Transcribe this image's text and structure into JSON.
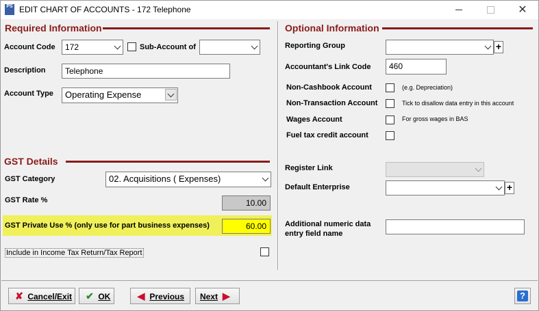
{
  "window": {
    "app_icon_text": "PS",
    "title": "EDIT CHART OF ACCOUNTS - 172 Telephone"
  },
  "required": {
    "section_title": "Required Information",
    "account_code_label": "Account Code",
    "account_code_value": "172",
    "sub_account_label": "Sub-Account of",
    "sub_account_value": "",
    "description_label": "Description",
    "description_value": "Telephone",
    "account_type_label": "Account Type",
    "account_type_value": "Operating Expense"
  },
  "gst": {
    "section_title": "GST Details",
    "category_label": "GST Category",
    "category_value": "02. Acquisitions ( Expenses)",
    "rate_label": "GST Rate %",
    "rate_value": "10.00",
    "private_use_label": "GST Private Use % (only use for part business expenses)",
    "private_use_value": "60.00",
    "include_label": "Include in Income Tax Return/Tax Report"
  },
  "optional": {
    "section_title": "Optional Information",
    "reporting_group_label": "Reporting Group",
    "reporting_group_value": "",
    "accountant_link_label": "Accountant's Link Code",
    "accountant_link_value": "460",
    "non_cashbook_label": "Non-Cashbook Account",
    "non_cashbook_hint": "(e.g. Depreciation)",
    "non_transaction_label": "Non-Transaction Account",
    "non_transaction_hint": "Tick to disallow data entry in this account",
    "wages_label": "Wages Account",
    "wages_hint": "For gross wages in BAS",
    "fuel_tax_label": "Fuel tax credit account",
    "register_link_label": "Register Link",
    "register_link_value": "",
    "default_enterprise_label": "Default Enterprise",
    "default_enterprise_value": "",
    "additional_label_line1": "Additional numeric data",
    "additional_label_line2": "entry field name",
    "additional_value": ""
  },
  "footer": {
    "cancel_label": "Cancel/Exit",
    "ok_label": "OK",
    "previous_label": "Previous",
    "next_label": "Next",
    "help_label": "?"
  },
  "colors": {
    "section_title": "#8b1a1a",
    "highlight": "#f0f05a"
  }
}
